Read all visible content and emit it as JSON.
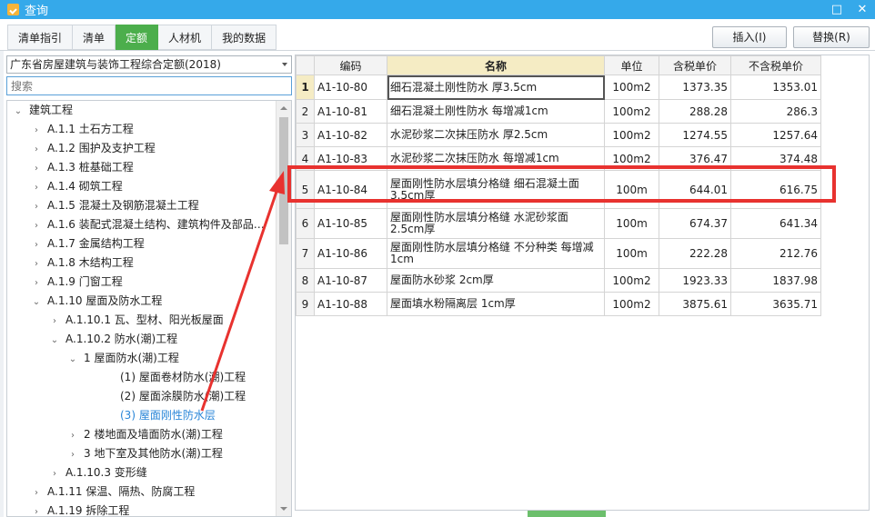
{
  "window": {
    "title": "查询",
    "close_glyph": "✕",
    "restore_glyph": "□"
  },
  "tabs": [
    {
      "label": "清单指引",
      "active": false
    },
    {
      "label": "清单",
      "active": false
    },
    {
      "label": "定额",
      "active": true
    },
    {
      "label": "人材机",
      "active": false
    },
    {
      "label": "我的数据",
      "active": false
    }
  ],
  "actions": {
    "insert_label": "插入(I)",
    "replace_label": "替换(R)"
  },
  "quota_select": {
    "value": "广东省房屋建筑与装饰工程综合定额(2018)"
  },
  "search": {
    "placeholder": "搜索",
    "value": ""
  },
  "tree": [
    {
      "label": "建筑工程",
      "level": 0,
      "state": "expanded"
    },
    {
      "label": "A.1.1 土石方工程",
      "level": 1,
      "state": "collapsed"
    },
    {
      "label": "A.1.2 围护及支护工程",
      "level": 1,
      "state": "collapsed"
    },
    {
      "label": "A.1.3 桩基础工程",
      "level": 1,
      "state": "collapsed"
    },
    {
      "label": "A.1.4 砌筑工程",
      "level": 1,
      "state": "collapsed"
    },
    {
      "label": "A.1.5 混凝土及钢筋混凝土工程",
      "level": 1,
      "state": "collapsed"
    },
    {
      "label": "A.1.6 装配式混凝土结构、建筑构件及部品…",
      "level": 1,
      "state": "collapsed"
    },
    {
      "label": "A.1.7 金属结构工程",
      "level": 1,
      "state": "collapsed"
    },
    {
      "label": "A.1.8 木结构工程",
      "level": 1,
      "state": "collapsed"
    },
    {
      "label": "A.1.9 门窗工程",
      "level": 1,
      "state": "collapsed"
    },
    {
      "label": "A.1.10 屋面及防水工程",
      "level": 1,
      "state": "expanded"
    },
    {
      "label": "A.1.10.1 瓦、型材、阳光板屋面",
      "level": 2,
      "state": "collapsed"
    },
    {
      "label": "A.1.10.2 防水(潮)工程",
      "level": 2,
      "state": "expanded"
    },
    {
      "label": "1 屋面防水(潮)工程",
      "level": 3,
      "state": "expanded"
    },
    {
      "label": "(1) 屋面卷材防水(潮)工程",
      "level": 5,
      "state": "leaf"
    },
    {
      "label": "(2) 屋面涂膜防水(潮)工程",
      "level": 5,
      "state": "leaf"
    },
    {
      "label": "(3) 屋面刚性防水层",
      "level": 5,
      "state": "leaf",
      "selected": true
    },
    {
      "label": "2 楼地面及墙面防水(潮)工程",
      "level": 3,
      "state": "collapsed"
    },
    {
      "label": "3 地下室及其他防水(潮)工程",
      "level": 3,
      "state": "collapsed"
    },
    {
      "label": "A.1.10.3 变形缝",
      "level": 2,
      "state": "collapsed"
    },
    {
      "label": "A.1.11 保温、隔热、防腐工程",
      "level": 1,
      "state": "collapsed"
    },
    {
      "label": "A.1.19 拆除工程",
      "level": 1,
      "state": "collapsed"
    }
  ],
  "grid": {
    "columns": [
      "",
      "编码",
      "名称",
      "单位",
      "含税单价",
      "不含税单价"
    ],
    "rows": [
      {
        "no": "1",
        "code": "A1-10-80",
        "name": "细石混凝土刚性防水 厚3.5cm",
        "unit": "100m2",
        "tax_price": "1373.35",
        "notax_price": "1353.01"
      },
      {
        "no": "2",
        "code": "A1-10-81",
        "name": "细石混凝土刚性防水 每增减1cm",
        "unit": "100m2",
        "tax_price": "288.28",
        "notax_price": "286.3"
      },
      {
        "no": "3",
        "code": "A1-10-82",
        "name": "水泥砂浆二次抹压防水 厚2.5cm",
        "unit": "100m2",
        "tax_price": "1274.55",
        "notax_price": "1257.64"
      },
      {
        "no": "4",
        "code": "A1-10-83",
        "name": "水泥砂浆二次抹压防水 每增减1cm",
        "unit": "100m2",
        "tax_price": "376.47",
        "notax_price": "374.48"
      },
      {
        "no": "5",
        "code": "A1-10-84",
        "name": "屋面刚性防水层填分格缝 细石混凝土面3.5cm厚",
        "unit": "100m",
        "tax_price": "644.01",
        "notax_price": "616.75"
      },
      {
        "no": "6",
        "code": "A1-10-85",
        "name": "屋面刚性防水层填分格缝 水泥砂浆面 2.5cm厚",
        "unit": "100m",
        "tax_price": "674.37",
        "notax_price": "641.34"
      },
      {
        "no": "7",
        "code": "A1-10-86",
        "name": "屋面刚性防水层填分格缝 不分种类 每增减1cm",
        "unit": "100m",
        "tax_price": "222.28",
        "notax_price": "212.76"
      },
      {
        "no": "8",
        "code": "A1-10-87",
        "name": "屋面防水砂浆 2cm厚",
        "unit": "100m2",
        "tax_price": "1923.33",
        "notax_price": "1837.98"
      },
      {
        "no": "9",
        "code": "A1-10-88",
        "name": "屋面填水粉隔离层 1cm厚",
        "unit": "100m2",
        "tax_price": "3875.61",
        "notax_price": "3635.71"
      }
    ]
  },
  "colors": {
    "titlebar": "#35a9ea",
    "active_tab": "#4cae4c",
    "annotation": "#e8322f",
    "selected_tree": "#2a86d8"
  }
}
